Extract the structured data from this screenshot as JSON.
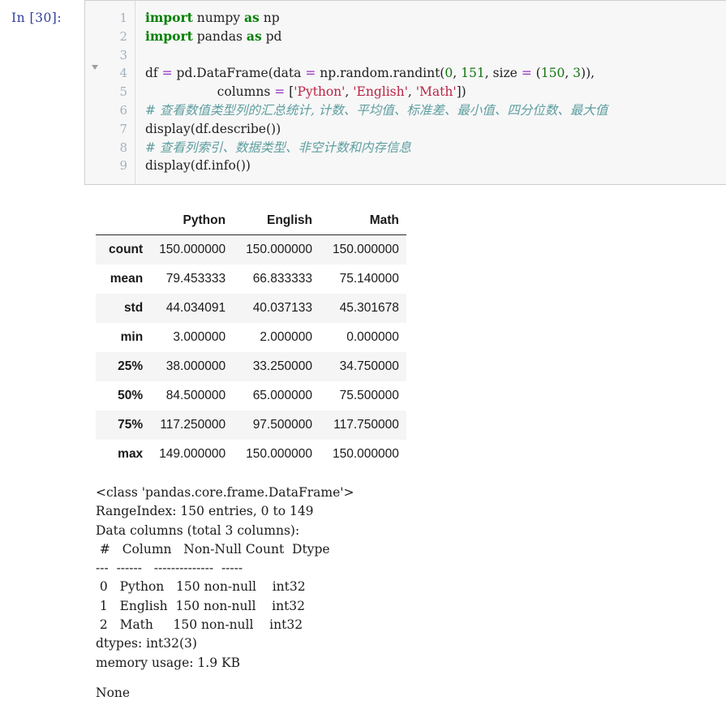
{
  "cell": {
    "prompt_label": "In  [30]:",
    "execution_count": 30,
    "line_numbers": [
      "1",
      "2",
      "3",
      "4",
      "5",
      "6",
      "7",
      "8",
      "9"
    ],
    "fold_marker": "collapse-triangle",
    "code_lines": [
      [
        {
          "t": "import",
          "c": "kw"
        },
        {
          "t": " numpy ",
          "c": "pln"
        },
        {
          "t": "as",
          "c": "kw"
        },
        {
          "t": " np",
          "c": "pln"
        }
      ],
      [
        {
          "t": "import",
          "c": "kw"
        },
        {
          "t": " pandas ",
          "c": "pln"
        },
        {
          "t": "as",
          "c": "kw"
        },
        {
          "t": " pd",
          "c": "pln"
        }
      ],
      [],
      [
        {
          "t": "df ",
          "c": "pln"
        },
        {
          "t": "=",
          "c": "op"
        },
        {
          "t": " pd.DataFrame(data ",
          "c": "pln"
        },
        {
          "t": "=",
          "c": "op"
        },
        {
          "t": " np.random.randint(",
          "c": "pln"
        },
        {
          "t": "0",
          "c": "num"
        },
        {
          "t": ", ",
          "c": "pln"
        },
        {
          "t": "151",
          "c": "num"
        },
        {
          "t": ", size ",
          "c": "pln"
        },
        {
          "t": "=",
          "c": "op"
        },
        {
          "t": " (",
          "c": "pln"
        },
        {
          "t": "150",
          "c": "num"
        },
        {
          "t": ", ",
          "c": "pln"
        },
        {
          "t": "3",
          "c": "num"
        },
        {
          "t": ")),",
          "c": "pln"
        }
      ],
      [
        {
          "t": "                  columns ",
          "c": "pln"
        },
        {
          "t": "=",
          "c": "op"
        },
        {
          "t": " [",
          "c": "pln"
        },
        {
          "t": "'Python'",
          "c": "str"
        },
        {
          "t": ", ",
          "c": "pln"
        },
        {
          "t": "'English'",
          "c": "str"
        },
        {
          "t": ", ",
          "c": "pln"
        },
        {
          "t": "'Math'",
          "c": "str"
        },
        {
          "t": "])",
          "c": "pln"
        }
      ],
      [
        {
          "t": "# 查看数值类型列的汇总统计, 计数、平均值、标准差、最小值、四分位数、最大值",
          "c": "cmt"
        }
      ],
      [
        {
          "t": "display(df.describe())",
          "c": "pln"
        }
      ],
      [
        {
          "t": "# 查看列索引、数据类型、非空计数和内存信息",
          "c": "cmt"
        }
      ],
      [
        {
          "t": "display(df.info())",
          "c": "pln"
        }
      ]
    ]
  },
  "output": {
    "describe_table": {
      "corner_label": "",
      "columns": [
        "Python",
        "English",
        "Math"
      ],
      "rows": [
        {
          "label": "count",
          "values": [
            "150.000000",
            "150.000000",
            "150.000000"
          ]
        },
        {
          "label": "mean",
          "values": [
            "79.453333",
            "66.833333",
            "75.140000"
          ]
        },
        {
          "label": "std",
          "values": [
            "44.034091",
            "40.037133",
            "45.301678"
          ]
        },
        {
          "label": "min",
          "values": [
            "3.000000",
            "2.000000",
            "0.000000"
          ]
        },
        {
          "label": "25%",
          "values": [
            "38.000000",
            "33.250000",
            "34.750000"
          ]
        },
        {
          "label": "50%",
          "values": [
            "84.500000",
            "65.000000",
            "75.500000"
          ]
        },
        {
          "label": "75%",
          "values": [
            "117.250000",
            "97.500000",
            "117.750000"
          ]
        },
        {
          "label": "max",
          "values": [
            "149.000000",
            "150.000000",
            "150.000000"
          ]
        }
      ]
    },
    "info_text": "<class 'pandas.core.frame.DataFrame'>\nRangeIndex: 150 entries, 0 to 149\nData columns (total 3 columns):\n #   Column   Non-Null Count  Dtype\n---  ------   --------------  -----\n 0   Python   150 non-null    int32\n 1   English  150 non-null    int32\n 2   Math     150 non-null    int32\ndtypes: int32(3)\nmemory usage: 1.9 KB",
    "none_text": "None"
  },
  "colors": {
    "prompt_blue": "#303f9f",
    "keyword_green": "#008000",
    "operator_purple": "#9333bb",
    "number_green": "#127512",
    "string_red": "#bb2244",
    "comment_teal": "#5f9ea0",
    "cell_background": "#f7f7f7",
    "cell_border": "#cfcfcf",
    "row_stripe": "#f5f5f5",
    "page_background": "#ffffff"
  }
}
